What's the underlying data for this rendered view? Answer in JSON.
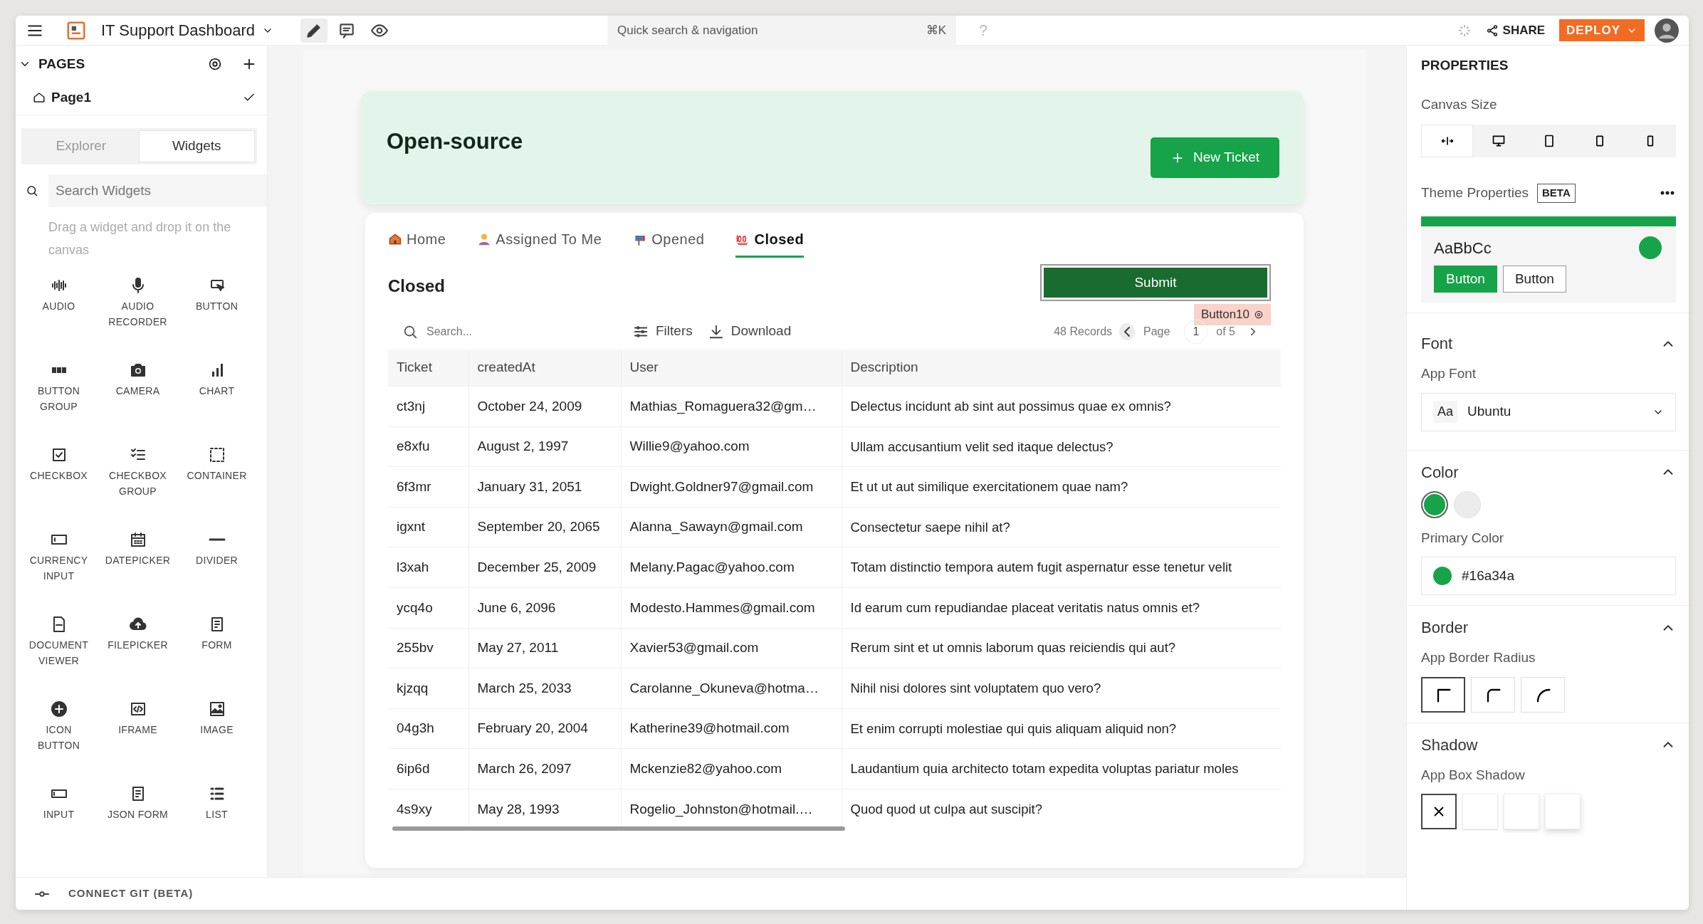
{
  "topbar": {
    "app_name": "IT Support Dashboard",
    "modes": [
      {
        "kind": "edit",
        "selected": true
      },
      {
        "kind": "comment",
        "selected": false
      },
      {
        "kind": "view",
        "selected": false
      }
    ],
    "search": {
      "placeholder": "Quick search & navigation",
      "shortcut": "⌘K"
    },
    "help": "?",
    "share": "SHARE",
    "deploy": "DEPLOY"
  },
  "sidebar": {
    "section": "PAGES",
    "expanded": true,
    "pages": [
      {
        "name": "Page1",
        "selected": true
      }
    ],
    "tabs": [
      {
        "label": "Explorer",
        "selected": false
      },
      {
        "label": "Widgets",
        "selected": true
      }
    ],
    "search": {
      "placeholder": "Search Widgets"
    },
    "hint": "Drag a widget and drop it on the canvas",
    "widgets": [
      {
        "label": "AUDIO",
        "kind": "audio"
      },
      {
        "label": "AUDIO RECORDER",
        "kind": "recorder"
      },
      {
        "label": "BUTTON",
        "kind": "button"
      },
      {
        "label": "BUTTON GROUP",
        "kind": "buttongroup"
      },
      {
        "label": "CAMERA",
        "kind": "camera"
      },
      {
        "label": "CHART",
        "kind": "chart"
      },
      {
        "label": "CHECKBOX",
        "kind": "checkbox"
      },
      {
        "label": "CHECKBOX GROUP",
        "kind": "checkgroup"
      },
      {
        "label": "CONTAINER",
        "kind": "container"
      },
      {
        "label": "CURRENCY INPUT",
        "kind": "currency"
      },
      {
        "label": "DATEPICKER",
        "kind": "date"
      },
      {
        "label": "DIVIDER",
        "kind": "divider"
      },
      {
        "label": "DOCUMENT VIEWER",
        "kind": "document"
      },
      {
        "label": "FILEPICKER",
        "kind": "file"
      },
      {
        "label": "FORM",
        "kind": "form"
      },
      {
        "label": "ICON BUTTON",
        "kind": "iconbutton"
      },
      {
        "label": "IFRAME",
        "kind": "iframe"
      },
      {
        "label": "IMAGE",
        "kind": "image"
      },
      {
        "label": "INPUT",
        "kind": "input"
      },
      {
        "label": "JSON FORM",
        "kind": "jsonform"
      },
      {
        "label": "LIST",
        "kind": "list"
      }
    ],
    "footer": "CONNECT GIT (BETA)"
  },
  "canvas": {
    "header": {
      "title": "Open-source",
      "button": "New Ticket"
    },
    "tabs": [
      {
        "label": "Home",
        "kind": "home",
        "selected": false
      },
      {
        "label": "Assigned To Me",
        "kind": "person",
        "selected": false
      },
      {
        "label": "Opened",
        "kind": "mailbox",
        "selected": false
      },
      {
        "label": "Closed",
        "kind": "hundred",
        "selected": true
      }
    ],
    "section_title": "Closed",
    "submit": "Submit",
    "widget_tag": "Button10",
    "table": {
      "search": {
        "placeholder": "Search..."
      },
      "filters": "Filters",
      "download": "Download",
      "records": "48 Records",
      "page_label": "Page",
      "page": "1",
      "page_count": "of 5",
      "columns": [
        "Ticket",
        "createdAt",
        "User",
        "Description"
      ],
      "rows": [
        [
          "ct3nj",
          "October 24, 2009",
          "Mathias_Romaguera32@gm…",
          "Delectus incidunt ab sint aut possimus quae ex omnis?"
        ],
        [
          "e8xfu",
          "August 2, 1997",
          "Willie9@yahoo.com",
          "Ullam accusantium velit sed itaque delectus?"
        ],
        [
          "6f3mr",
          "January 31, 2051",
          "Dwight.Goldner97@gmail.com",
          "Et ut ut aut similique exercitationem quae nam?"
        ],
        [
          "igxnt",
          "September 20, 2065",
          "Alanna_Sawayn@gmail.com",
          "Consectetur saepe nihil at?"
        ],
        [
          "l3xah",
          "December 25, 2009",
          "Melany.Pagac@yahoo.com",
          "Totam distinctio tempora autem fugit aspernatur esse tenetur velit"
        ],
        [
          "ycq4o",
          "June 6, 2096",
          "Modesto.Hammes@gmail.com",
          "Id earum cum repudiandae placeat veritatis natus omnis et?"
        ],
        [
          "255bv",
          "May 27, 2011",
          "Xavier53@gmail.com",
          "Rerum sint et ut omnis laborum quas reiciendis qui aut?"
        ],
        [
          "kjzqq",
          "March 25, 2033",
          "Carolanne_Okuneva@hotma…",
          "Nihil nisi dolores sint voluptatem quo vero?"
        ],
        [
          "04g3h",
          "February 20, 2004",
          "Katherine39@hotmail.com",
          "Et enim corrupti molestiae qui quis aliquam aliquid non?"
        ],
        [
          "6ip6d",
          "March 26, 2097",
          "Mckenzie82@yahoo.com",
          "Laudantium quia architecto totam expedita voluptas pariatur moles"
        ],
        [
          "4s9xy",
          "May 28, 1993",
          "Rogelio_Johnston@hotmail.…",
          "Quod quod ut culpa aut suscipit?"
        ]
      ]
    }
  },
  "properties": {
    "title": "PROPERTIES",
    "canvas_size": {
      "label": "Canvas Size",
      "options": [
        {
          "kind": "fluid",
          "selected": true
        },
        {
          "kind": "desktop",
          "selected": false
        },
        {
          "kind": "tablet_landscape",
          "selected": false
        },
        {
          "kind": "tablet",
          "selected": false
        },
        {
          "kind": "phone",
          "selected": false
        }
      ]
    },
    "theme": {
      "label": "Theme Properties",
      "badge": "BETA",
      "preview_text": "AaBbCc",
      "buttons": [
        "Button",
        "Button"
      ]
    },
    "font": {
      "label": "Font",
      "expanded": true,
      "field_label": "App Font",
      "prefix": "Aa",
      "value": "Ubuntu"
    },
    "color": {
      "label": "Color",
      "expanded": true,
      "swatches": [
        {
          "color": "#16a34a",
          "selected": true
        },
        {
          "color": "#ececec",
          "selected": false
        }
      ],
      "field_label": "Primary Color",
      "primary": {
        "color": "#16a34a",
        "value": "#16a34a"
      }
    },
    "border": {
      "label": "Border",
      "expanded": true,
      "field_label": "App Border Radius",
      "options": [
        {
          "kind": "none",
          "selected": true
        },
        {
          "kind": "medium",
          "selected": false
        },
        {
          "kind": "large",
          "selected": false
        }
      ]
    },
    "shadow": {
      "label": "Shadow",
      "expanded": true,
      "field_label": "App Box Shadow",
      "options": [
        {
          "kind": "none",
          "selected": true
        },
        {
          "kind": "small",
          "selected": false
        },
        {
          "kind": "medium",
          "selected": false
        },
        {
          "kind": "large",
          "selected": false
        }
      ]
    }
  }
}
